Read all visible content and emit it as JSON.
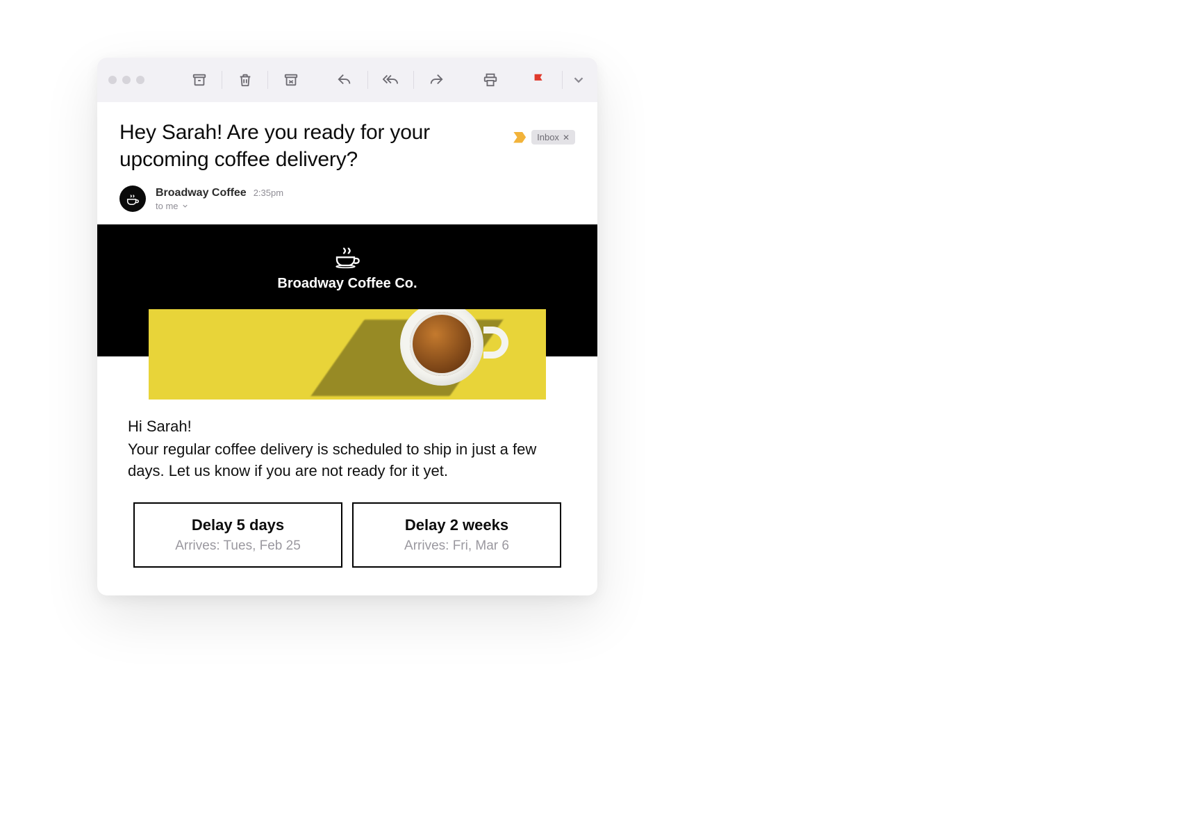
{
  "email": {
    "subject": "Hey Sarah!  Are you ready for your upcoming coffee delivery?",
    "label": "Inbox",
    "sender_name": "Broadway Coffee",
    "time": "2:35pm",
    "to_line": "to me",
    "brand": "Broadway Coffee Co.",
    "greeting": "Hi Sarah!",
    "body": "Your regular coffee delivery is scheduled to ship in just a few days. Let us know if you are not ready for it yet.",
    "delay_options": [
      {
        "title": "Delay 5 days",
        "sub": "Arrives: Tues, Feb 25"
      },
      {
        "title": "Delay 2 weeks",
        "sub": "Arrives: Fri, Mar 6"
      }
    ]
  }
}
